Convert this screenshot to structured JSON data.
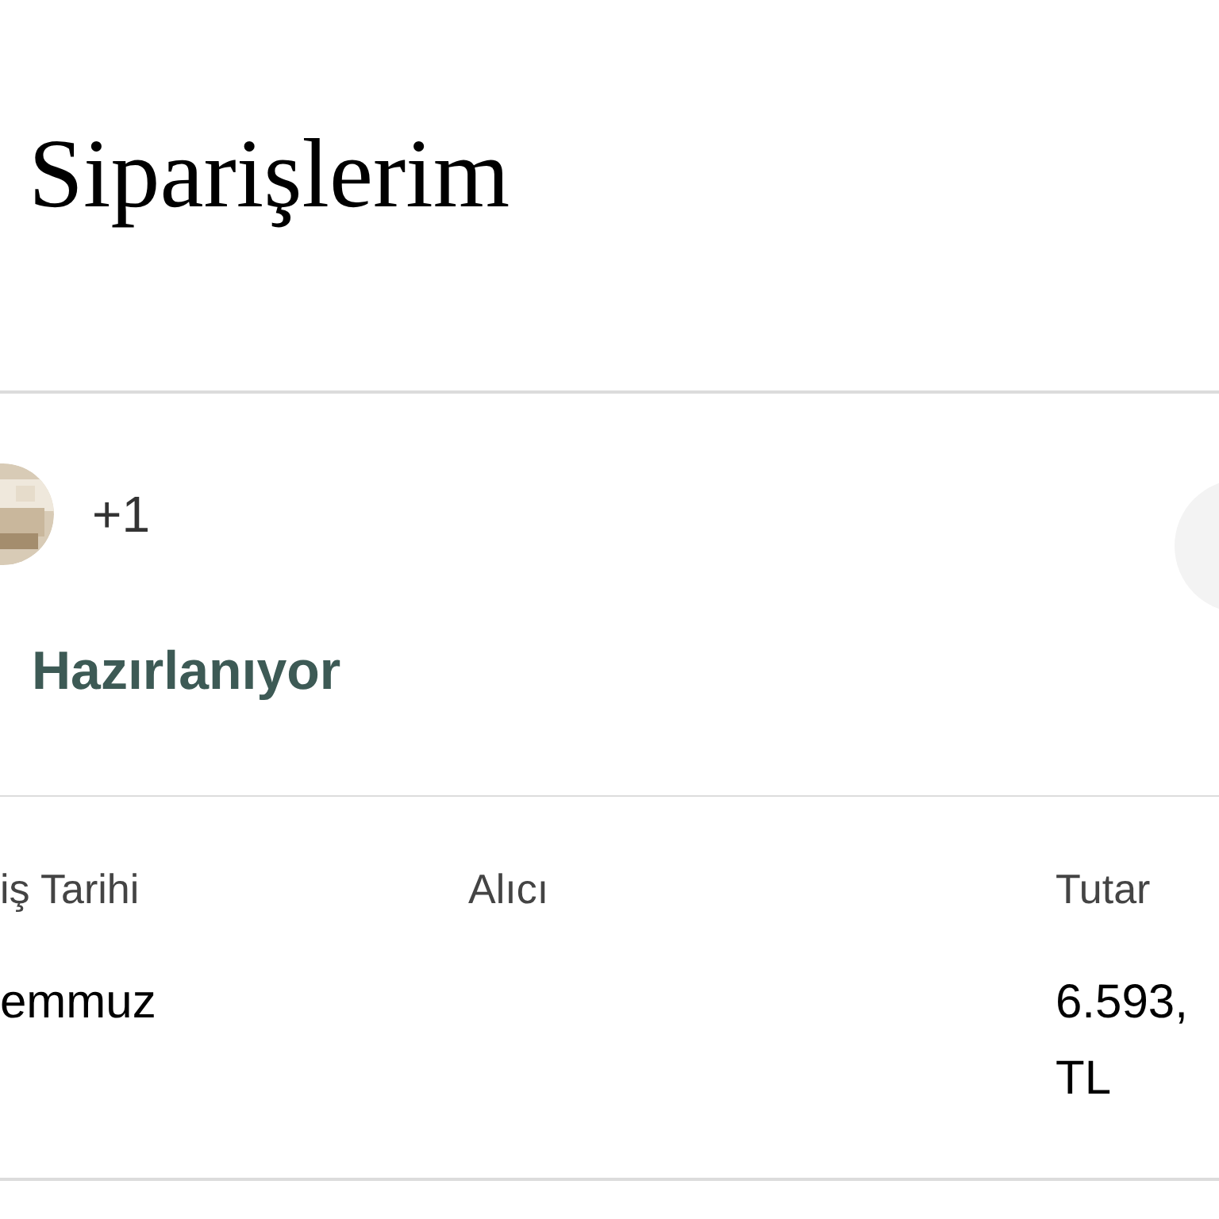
{
  "page": {
    "title": "Siparişlerim"
  },
  "order": {
    "extra_count": "+1",
    "status": "Hazırlanıyor",
    "columns": [
      {
        "label": "iş Tarihi",
        "lines": [
          "emmuz"
        ]
      },
      {
        "label": "Alıcı"
      },
      {
        "label": "Tutar",
        "lines": [
          "6.593,",
          "TL"
        ]
      }
    ]
  }
}
